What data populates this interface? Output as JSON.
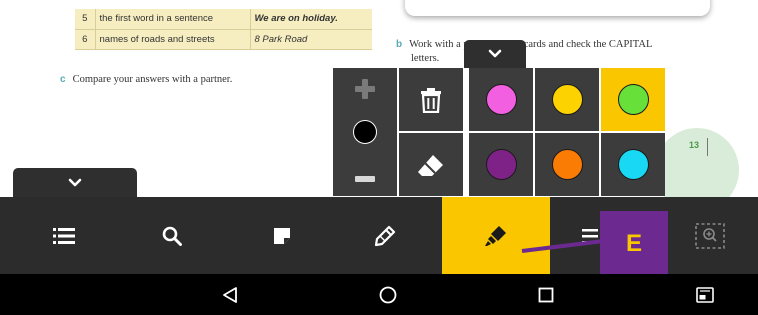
{
  "table": {
    "rows": [
      {
        "num": "5",
        "rule": "the first word in a sentence",
        "example": "We are on holiday."
      },
      {
        "num": "6",
        "rule": "names of roads and streets",
        "example": "8 Park Road"
      }
    ]
  },
  "tasks": {
    "b": {
      "letter": "b",
      "line1": "Work with a partner. Swap cards and check the CAPITAL",
      "line2": "letters."
    },
    "c": {
      "letter": "c",
      "text": "Compare your answers with a partner."
    }
  },
  "page_number": "13",
  "palette": {
    "size_increase_icon": "plus-icon",
    "size_decrease_icon": "minus-icon",
    "delete_icon": "trash-icon",
    "eraser_icon": "eraser-icon",
    "colors": [
      {
        "name": "pink",
        "hex": "#f25fe0"
      },
      {
        "name": "yellow",
        "hex": "#fcd200"
      },
      {
        "name": "green",
        "hex": "#68e03a"
      },
      {
        "name": "purple",
        "hex": "#7e2287"
      },
      {
        "name": "orange",
        "hex": "#fb7c05"
      },
      {
        "name": "cyan",
        "hex": "#19d8f3"
      }
    ],
    "selected_color": "green",
    "selected_color_cell": "#f9c600"
  },
  "toolbar": {
    "items": [
      "list-icon",
      "search-icon",
      "note-icon",
      "pencil-icon",
      "highlighter-icon",
      "menu-icon",
      "zoom-icon"
    ],
    "active_item": "highlighter-icon",
    "background": "#2c2c2c",
    "accent": "#f9c600"
  },
  "annotation": {
    "label": "E",
    "color": "#6c2a91"
  },
  "navbar": {
    "items": [
      "back-icon",
      "home-icon",
      "recents-icon",
      "screenshot-icon"
    ]
  }
}
